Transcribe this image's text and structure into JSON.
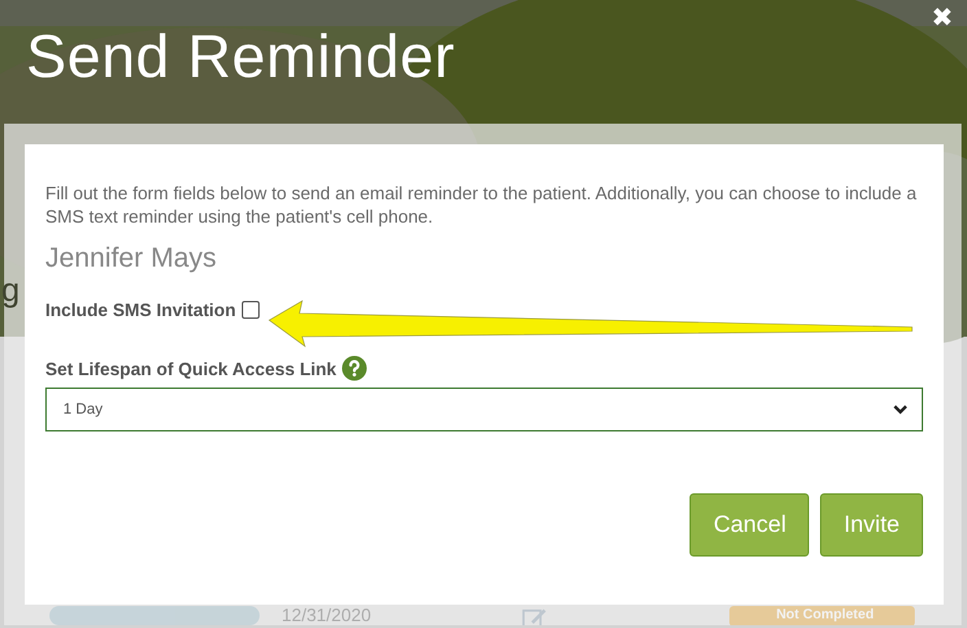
{
  "dialog": {
    "title": "Send Reminder",
    "close": "✖",
    "description": "Fill out the form fields below to send an email reminder to the patient. Additionally, you can choose to include a SMS text reminder using the patient's cell phone.",
    "patient_name": "Jennifer Mays",
    "sms": {
      "label": "Include SMS Invitation",
      "checked": false
    },
    "lifespan": {
      "label": "Set Lifespan of Quick Access Link",
      "value": "1 Day"
    },
    "buttons": [
      "Cancel",
      "Invite"
    ]
  },
  "background_page": {
    "cut_text": "g",
    "date": "12/31/2020",
    "status_badge": "Not Completed"
  }
}
